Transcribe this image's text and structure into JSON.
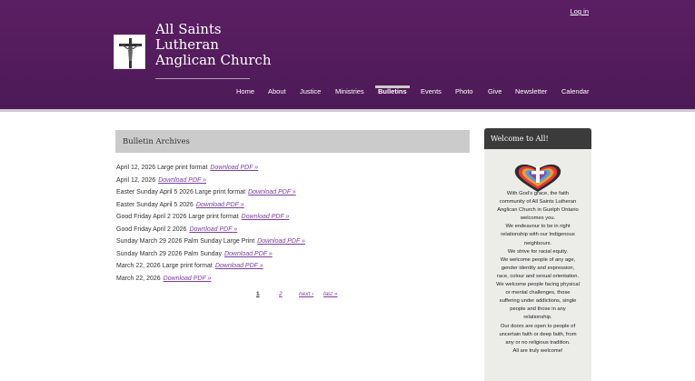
{
  "header": {
    "login": "Log in",
    "church_name": [
      "All Saints",
      "Lutheran",
      "Anglican Church"
    ],
    "colors": {
      "bg": "#5a1f63",
      "accent": "#7a3ea0"
    }
  },
  "nav": {
    "items": [
      "Home",
      "About",
      "Justice",
      "Ministries",
      "Bulletins",
      "Events",
      "Photo",
      "Give",
      "Newsletter",
      "Calendar"
    ],
    "active": "Bulletins"
  },
  "archive": {
    "title": "Bulletin Archives",
    "download_label": "Download PDF »",
    "items": [
      "April 12, 2026 Large print format",
      "April 12, 2026",
      "Easter Sunday April 5 2026 Large print format",
      "Easter Sunday April 5 2026",
      "Good Friday April 2 2026 Large print format",
      "Good Friday April 2 2026",
      "Sunday March 29 2026 Palm Sunday Large Print",
      "Sunday March 29 2026 Palm Sunday",
      "March 22, 2026 Large print format",
      "March 22, 2026"
    ]
  },
  "pager": {
    "current": "1",
    "page2": "2",
    "next": "next ›",
    "last": "last »"
  },
  "sidebar": {
    "title": "Welcome to All!",
    "lines": [
      "With God’s grace, the faith",
      "community of All Saints Lutheran",
      "Anglican Church in Guelph Ontario",
      "welcomes you.",
      "We endeavour to be in right",
      "relationship with our Indigenous",
      "neighbours.",
      "We strive for racial equity.",
      "We welcome people of any age,",
      "gender identity and expression,",
      "race, colour and sexual orientation.",
      "We welcome people facing physical",
      "or mental challenges, those",
      "suffering under addictions, single",
      "people and those in any",
      "relationship.",
      "Our doors are open to people of",
      "uncertain faith or deep faith, from",
      "any or no religious tradition.",
      "All are truly welcome!"
    ]
  }
}
